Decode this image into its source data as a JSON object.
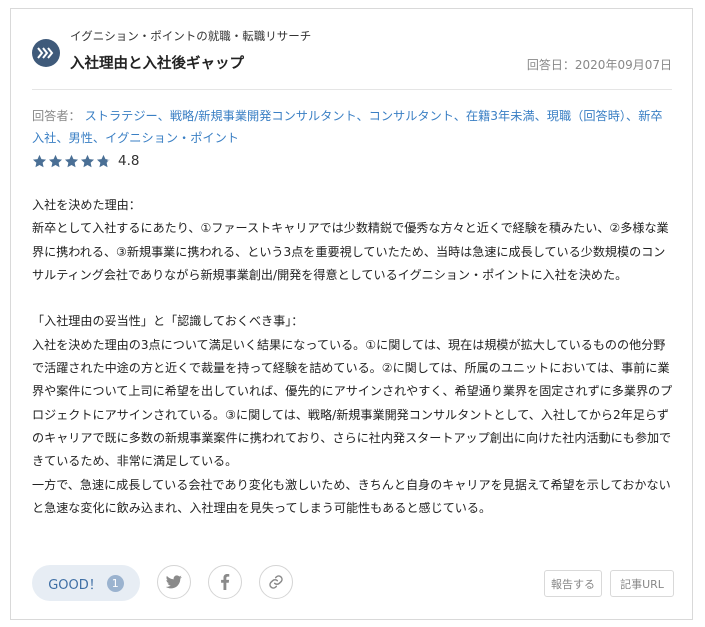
{
  "header": {
    "company": "イグニション・ポイントの就職・転職リサーチ",
    "title": "入社理由と入社後ギャップ",
    "answer_date": "回答日：2020年09月07日"
  },
  "respondent": {
    "label": "回答者：",
    "info": "ストラテジー、戦略/新規事業開発コンサルタント、コンサルタント、在籍3年未満、現職（回答時）、新卒入社、男性、イグニション・ポイント"
  },
  "rating": {
    "value": "4.8",
    "stars_filled": 4.8,
    "stars_total": 5,
    "star_color": "#4a6f95"
  },
  "review": {
    "text": "入社を決めた理由：\n新卒として入社するにあたり、①ファーストキャリアでは少数精鋭で優秀な方々と近くで経験を積みたい、②多様な業界に携われる、③新規事業に携われる、という3点を重要視していたため、当時は急速に成長している少数規模のコンサルティング会社でありながら新規事業創出/開発を得意としているイグニション・ポイントに入社を決めた。\n\n「入社理由の妥当性」と「認識しておくべき事」：\n入社を決めた理由の3点について満足いく結果になっている。①に関しては、現在は規模が拡大しているものの他分野で活躍された中途の方と近くで裁量を持って経験を詰めている。②に関しては、所属のユニットにおいては、事前に業界や案件について上司に希望を出していれば、優先的にアサインされやすく、希望通り業界を固定されずに多業界のプロジェクトにアサインされている。③に関しては、戦略/新規事業開発コンサルタントとして、入社してから2年足らずのキャリアで既に多数の新規事業案件に携われており、さらに社内発スタートアップ創出に向けた社内活動にも参加できているため、非常に満足している。\n一方で、急速に成長している会社であり変化も激しいため、きちんと自身のキャリアを見据えて希望を示しておかないと急速な変化に飲み込まれ、入社理由を見失ってしまう可能性もあると感じている。"
  },
  "footer": {
    "good_label": "GOOD！",
    "good_count": "1",
    "report_label": "報告する",
    "url_label": "記事URL",
    "share_icons": [
      "twitter-icon",
      "facebook-icon",
      "link-icon"
    ]
  },
  "colors": {
    "accent": "#3a7fc4",
    "logo_bg": "#3f5a7a"
  }
}
